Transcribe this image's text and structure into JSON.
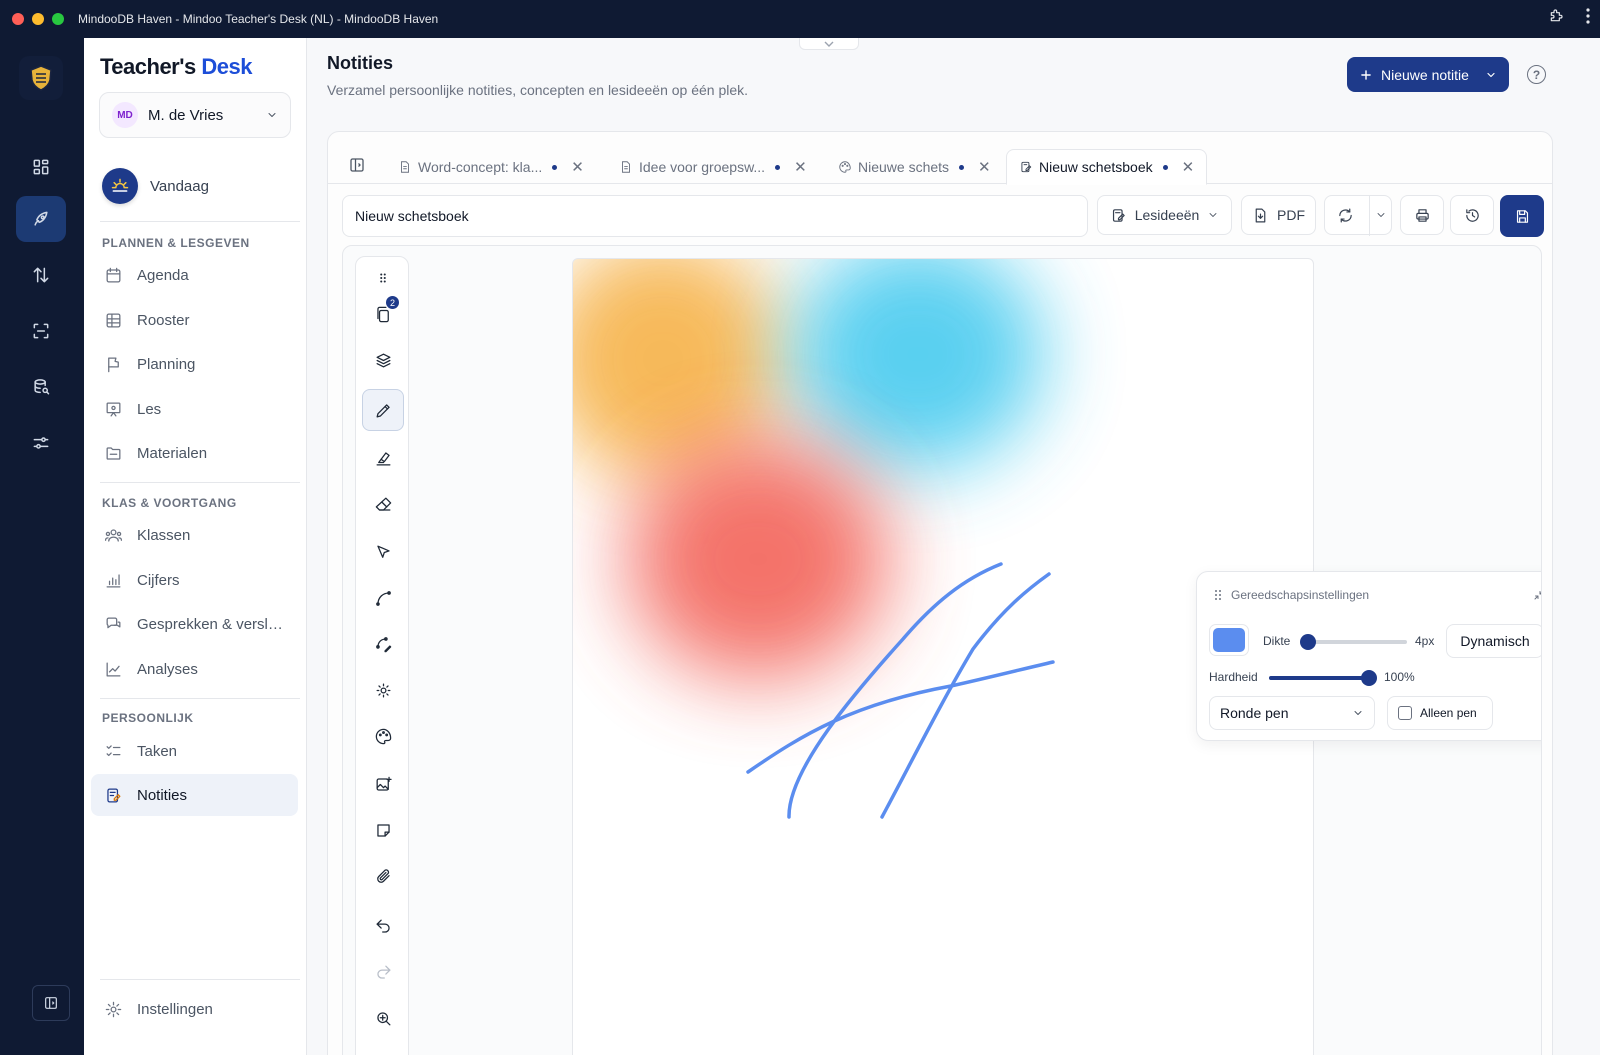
{
  "window": {
    "title": "MindooDB Haven - Mindoo Teacher's Desk (NL) - MindooDB Haven"
  },
  "rail": {
    "items": [
      {
        "icon": "dashboard-icon"
      },
      {
        "icon": "rocket-icon",
        "active": true
      },
      {
        "icon": "sort-arrows-icon"
      },
      {
        "icon": "scan-icon"
      },
      {
        "icon": "database-search-icon"
      },
      {
        "icon": "sliders-icon"
      }
    ]
  },
  "sidebar": {
    "brand_main": "Teacher's",
    "brand_accent": "Desk",
    "user": {
      "initials": "MD",
      "name": "M. de Vries"
    },
    "today_label": "Vandaag",
    "sections": [
      {
        "title": "PLANNEN & LESGEVEN",
        "items": [
          "Agenda",
          "Rooster",
          "Planning",
          "Les",
          "Materialen"
        ]
      },
      {
        "title": "KLAS & VOORTGANG",
        "items": [
          "Klassen",
          "Cijfers",
          "Gesprekken & versla...",
          "Analyses"
        ]
      },
      {
        "title": "PERSOONLIJK",
        "items": [
          "Taken",
          "Notities"
        ]
      }
    ],
    "active_item": "Notities",
    "settings_label": "Instellingen"
  },
  "header": {
    "title": "Notities",
    "subtitle": "Verzamel persoonlijke notities, concepten en lesideeën op één plek.",
    "new_button": "Nieuwe notitie"
  },
  "tabs": [
    {
      "label": "Word-concept: kla...",
      "icon": "document-icon",
      "unsaved": true
    },
    {
      "label": "Idee voor groepsw...",
      "icon": "document-icon",
      "unsaved": true
    },
    {
      "label": "Nieuwe schets",
      "icon": "palette-icon",
      "unsaved": true
    },
    {
      "label": "Nieuw schetsboek",
      "icon": "sketchbook-icon",
      "unsaved": true,
      "active": true
    }
  ],
  "editor": {
    "title_value": "Nieuw schetsboek",
    "category": "Lesideeën",
    "pdf_label": "PDF"
  },
  "tools": {
    "pages_badge": "2",
    "active": "pen"
  },
  "tool_settings": {
    "title": "Gereedschapsinstellingen",
    "color": "#5b8def",
    "thickness_label": "Dikte",
    "thickness_value": "4px",
    "thickness_level": 0.05,
    "dynamic_label": "Dynamisch",
    "hardness_label": "Hardheid",
    "hardness_value": "100%",
    "hardness_level": 1.0,
    "pen_type": "Ronde pen",
    "pen_only_label": "Alleen pen",
    "pen_only_checked": false
  },
  "colors": {
    "brand": "#1e3a8a",
    "blob_orange": "#f6b24a",
    "blob_blue": "#3cc8ee",
    "blob_red": "#f25a50",
    "stroke": "#5b8def"
  }
}
